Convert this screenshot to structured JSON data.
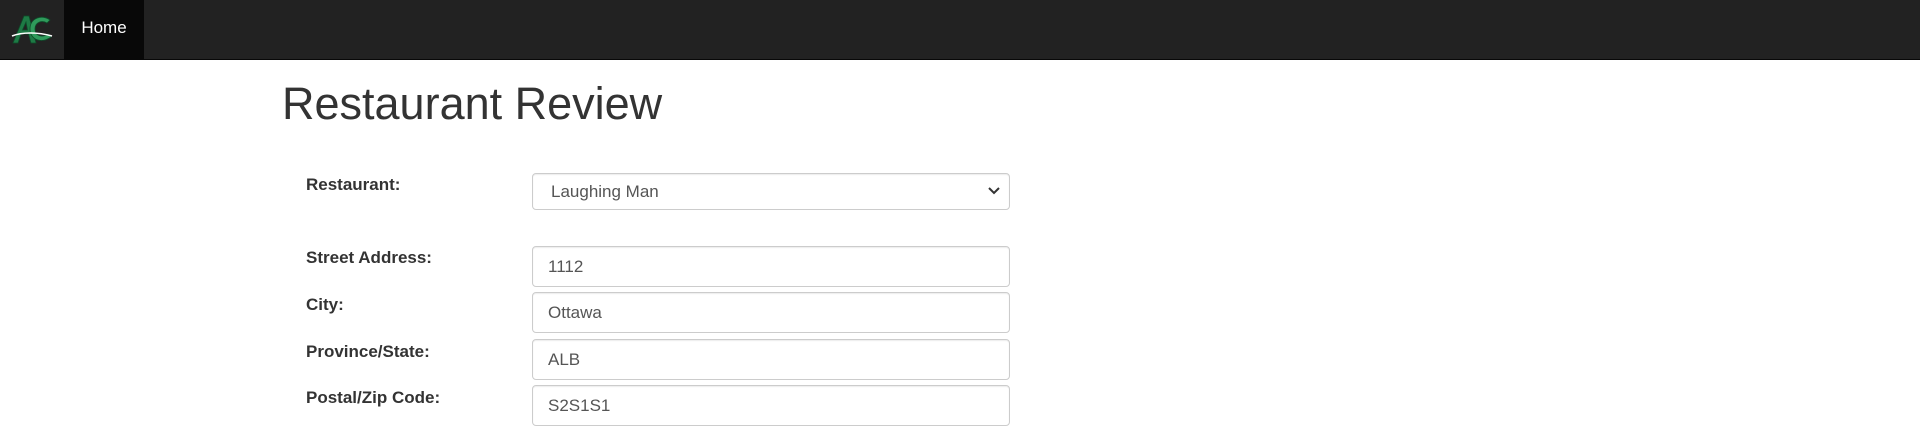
{
  "navbar": {
    "logo_text": "AC",
    "home_label": "Home"
  },
  "page": {
    "title": "Restaurant Review"
  },
  "form": {
    "restaurant": {
      "label": "Restaurant:",
      "selected": "Laughing Man"
    },
    "street_address": {
      "label": "Street Address:",
      "value": "1112"
    },
    "city": {
      "label": "City:",
      "value": "Ottawa"
    },
    "province_state": {
      "label": "Province/State:",
      "value": "ALB"
    },
    "postal_zip": {
      "label": "Postal/Zip Code:",
      "value": "S2S1S1"
    }
  },
  "colors": {
    "navbar_bg": "#222222",
    "active_nav_bg": "#080808",
    "logo_green": "#1e7a45"
  }
}
